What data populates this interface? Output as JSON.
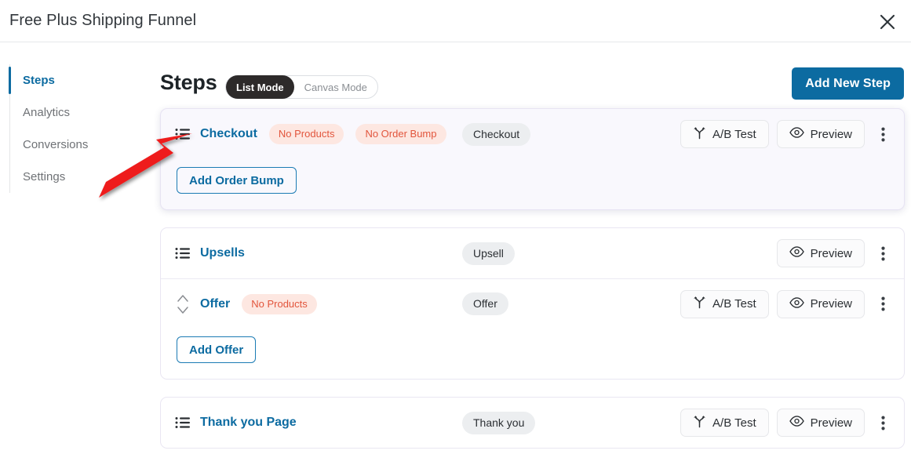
{
  "window": {
    "title": "Free Plus Shipping Funnel",
    "close_icon": "close-icon"
  },
  "sidebar": {
    "items": [
      {
        "label": "Steps",
        "active": true
      },
      {
        "label": "Analytics",
        "active": false
      },
      {
        "label": "Conversions",
        "active": false
      },
      {
        "label": "Settings",
        "active": false
      }
    ]
  },
  "header": {
    "title": "Steps",
    "modes": [
      {
        "label": "List Mode",
        "active": true
      },
      {
        "label": "Canvas Mode",
        "active": false
      }
    ],
    "add_step_label": "Add New Step"
  },
  "actions": {
    "ab_test_label": "A/B Test",
    "preview_label": "Preview",
    "ab_test_icon": "split-arrow-icon",
    "preview_icon": "eye-icon",
    "kebab_icon": "more-vertical-icon",
    "list_handle_icon": "list-drag-icon",
    "sort_handle_icon": "sort-updown-icon"
  },
  "cards": [
    {
      "highlight": true,
      "rows": [
        {
          "name": "Checkout",
          "handle": "list",
          "errors": [
            "No Products",
            "No Order Bump"
          ],
          "type": "Checkout",
          "ab_test": true,
          "preview": true,
          "kebab": true
        }
      ],
      "footer_button": "Add Order Bump"
    },
    {
      "highlight": false,
      "rows": [
        {
          "name": "Upsells",
          "handle": "list",
          "errors": [],
          "type": "Upsell",
          "ab_test": false,
          "preview": true,
          "kebab": true
        },
        {
          "name": "Offer",
          "handle": "sort",
          "errors": [
            "No Products"
          ],
          "type": "Offer",
          "ab_test": true,
          "preview": true,
          "kebab": true
        }
      ],
      "footer_button": "Add Offer"
    },
    {
      "highlight": false,
      "rows": [
        {
          "name": "Thank you Page",
          "handle": "list",
          "errors": [],
          "type": "Thank you",
          "ab_test": true,
          "preview": true,
          "kebab": true
        }
      ],
      "footer_button": null
    }
  ],
  "annotation": {
    "type": "red-arrow",
    "color": "#ee1b1b",
    "points_at": "checkout-row-drag-handle"
  },
  "colors": {
    "accent_blue": "#0c6ba1",
    "error_text": "#e2553c",
    "error_bg": "#fde7e1",
    "badge_bg": "#eceef0",
    "highlight_card_bg": "#f9f8fd",
    "toggle_active_bg": "#2d2a2a"
  }
}
